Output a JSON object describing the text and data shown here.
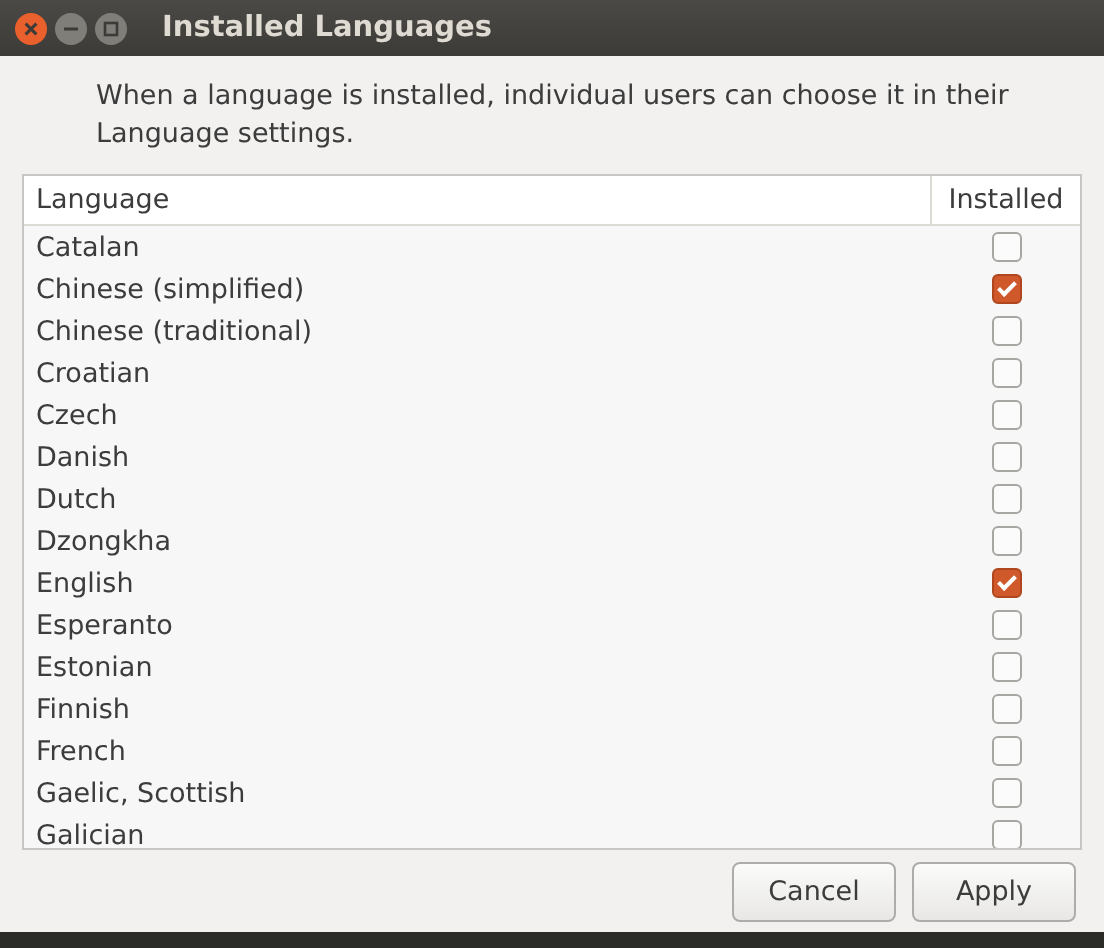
{
  "window": {
    "title": "Installed Languages"
  },
  "description": "When a language is installed, individual users can choose it in their Language settings.",
  "table": {
    "columns": [
      "Language",
      "Installed"
    ],
    "rows": [
      {
        "language": "Catalan",
        "checked": false
      },
      {
        "language": "Chinese (simplified)",
        "checked": true
      },
      {
        "language": "Chinese (traditional)",
        "checked": false
      },
      {
        "language": "Croatian",
        "checked": false
      },
      {
        "language": "Czech",
        "checked": false
      },
      {
        "language": "Danish",
        "checked": false
      },
      {
        "language": "Dutch",
        "checked": false
      },
      {
        "language": "Dzongkha",
        "checked": false
      },
      {
        "language": "English",
        "checked": true
      },
      {
        "language": "Esperanto",
        "checked": false
      },
      {
        "language": "Estonian",
        "checked": false
      },
      {
        "language": "Finnish",
        "checked": false
      },
      {
        "language": "French",
        "checked": false
      },
      {
        "language": "Gaelic, Scottish",
        "checked": false
      },
      {
        "language": "Galician",
        "checked": false
      }
    ]
  },
  "buttons": [
    "Cancel",
    "Apply"
  ]
}
